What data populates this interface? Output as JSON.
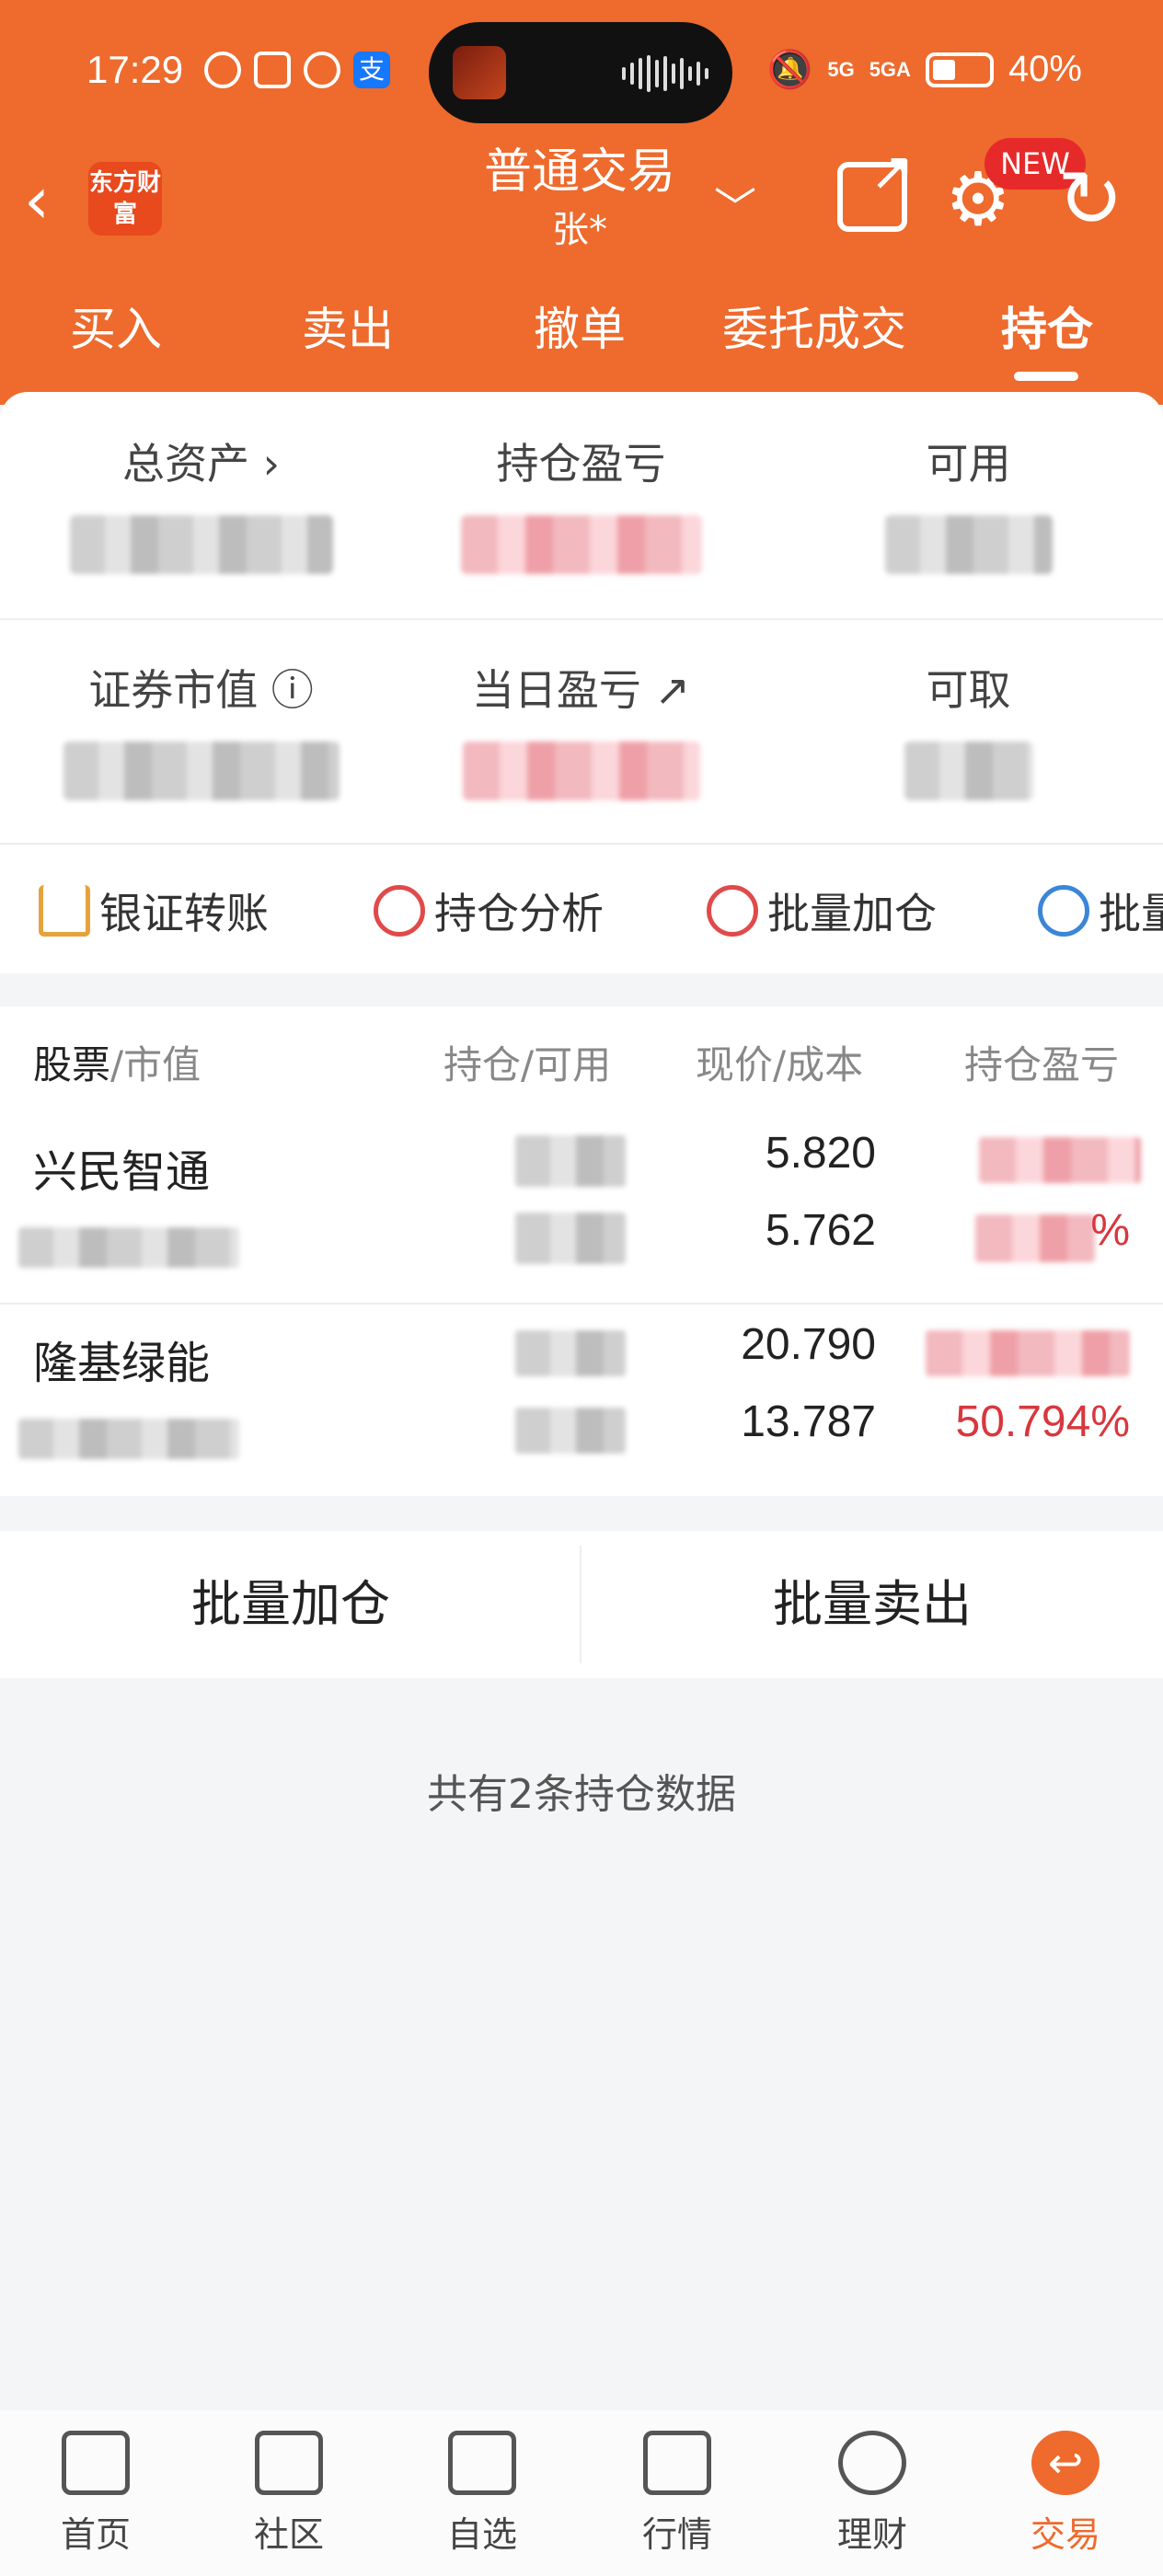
{
  "status_bar": {
    "time": "17:29",
    "battery": "40%",
    "signal_1": "5G",
    "signal_2": "5GA"
  },
  "nav": {
    "title": "普通交易",
    "account": "张*",
    "logo_text": "东方财富",
    "new_badge": "NEW"
  },
  "tabs": [
    {
      "label": "买入"
    },
    {
      "label": "卖出"
    },
    {
      "label": "撤单"
    },
    {
      "label": "委托成交"
    },
    {
      "label": "持仓",
      "active": true
    }
  ],
  "assets": {
    "total_assets_label": "总资产 ›",
    "holding_pl_label": "持仓盈亏",
    "available_label": "可用",
    "market_value_label": "证券市值 ⓘ",
    "daily_pl_label": "当日盈亏 ↗",
    "withdrawable_label": "可取"
  },
  "quick_actions": [
    {
      "label": "银证转账",
      "icon": "transfer-icon"
    },
    {
      "label": "持仓分析",
      "icon": "pie-chart-icon"
    },
    {
      "label": "批量加仓",
      "icon": "batch-add-icon"
    },
    {
      "label": "批量",
      "icon": "batch-icon"
    }
  ],
  "table": {
    "headers": {
      "stock": "股票",
      "market_value": "/市值",
      "position": "持仓/可用",
      "price": "现价/成本",
      "pl": "持仓盈亏"
    },
    "rows": [
      {
        "name": "兴民智通",
        "price": "5.820",
        "cost": "5.762",
        "pl_pct": "%"
      },
      {
        "name": "隆基绿能",
        "price": "20.790",
        "cost": "13.787",
        "pl_pct": "50.794%"
      }
    ]
  },
  "batch": {
    "add_label": "批量加仓",
    "sell_label": "批量卖出"
  },
  "summary_text": "共有2条持仓数据",
  "bottom_nav": [
    {
      "label": "首页",
      "icon": "home-icon"
    },
    {
      "label": "社区",
      "icon": "community-icon"
    },
    {
      "label": "自选",
      "icon": "watchlist-icon"
    },
    {
      "label": "行情",
      "icon": "market-icon"
    },
    {
      "label": "理财",
      "icon": "wealth-icon"
    },
    {
      "label": "交易",
      "icon": "trade-icon",
      "active": true
    }
  ],
  "colors": {
    "brand": "#ee6a2d",
    "up_red": "#d9363e",
    "new_badge": "#e62a2a"
  }
}
